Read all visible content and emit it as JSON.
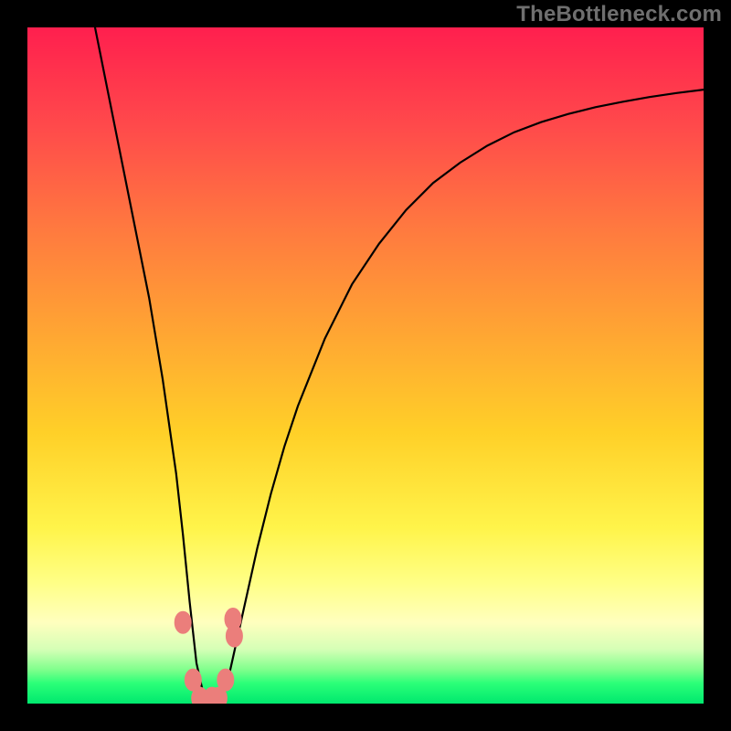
{
  "watermark": {
    "text": "TheBottleneck.com"
  },
  "colors": {
    "curve_stroke": "#000000",
    "marker_fill": "#eb7e7b",
    "marker_stroke": "#eb7e7b",
    "frame_bg": "#000000"
  },
  "chart_data": {
    "type": "line",
    "title": "",
    "xlabel": "",
    "ylabel": "",
    "xlim": [
      0,
      100
    ],
    "ylim": [
      0,
      100
    ],
    "grid": false,
    "legend": false,
    "series": [
      {
        "name": "bottleneck-curve",
        "x": [
          10,
          12,
          14,
          16,
          18,
          20,
          22,
          23,
          24,
          25,
          26,
          27,
          28,
          29,
          30,
          32,
          34,
          36,
          38,
          40,
          44,
          48,
          52,
          56,
          60,
          64,
          68,
          72,
          76,
          80,
          84,
          88,
          92,
          96,
          100
        ],
        "y": [
          100,
          90,
          80,
          70,
          60,
          48,
          34,
          25,
          15,
          6,
          1.5,
          0.2,
          0.2,
          1.5,
          5,
          14,
          23,
          31,
          38,
          44,
          54,
          62,
          68,
          73,
          77,
          80,
          82.5,
          84.5,
          86,
          87.2,
          88.2,
          89,
          89.7,
          90.3,
          90.8
        ]
      }
    ],
    "markers": [
      {
        "x": 23.0,
        "y": 12.0
      },
      {
        "x": 24.5,
        "y": 3.5
      },
      {
        "x": 25.5,
        "y": 0.8
      },
      {
        "x": 27.3,
        "y": 0.8
      },
      {
        "x": 28.3,
        "y": 0.8
      },
      {
        "x": 29.3,
        "y": 3.5
      },
      {
        "x": 30.4,
        "y": 12.5
      },
      {
        "x": 30.6,
        "y": 10.0
      }
    ]
  }
}
